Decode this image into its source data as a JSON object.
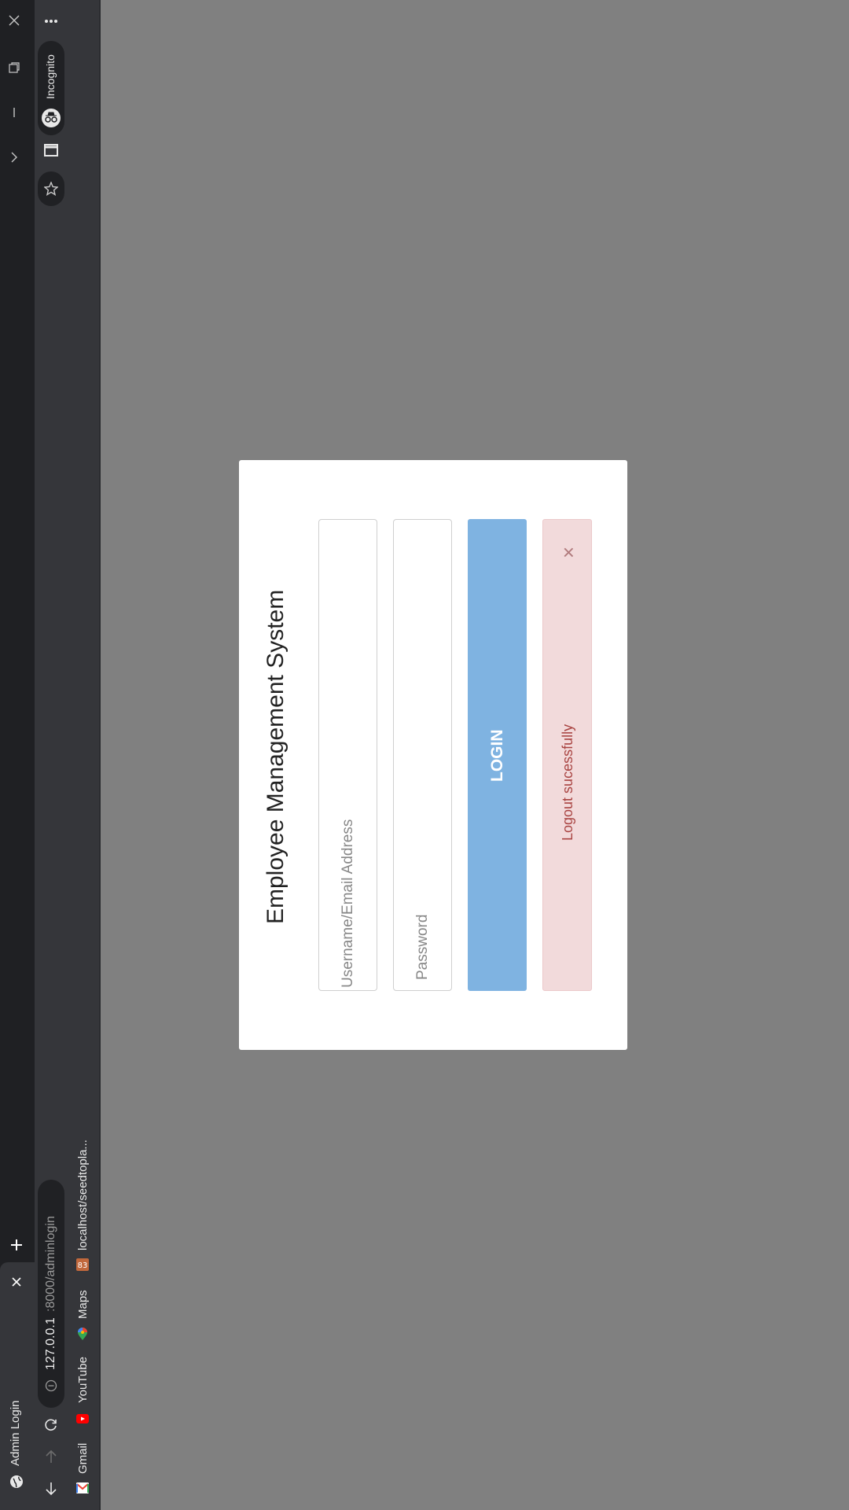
{
  "browser": {
    "tab_title": "Admin Login",
    "incognito_label": "Incognito",
    "url_host": "127.0.0.1",
    "url_rest": ":8000/adminlogin",
    "bookmarks": [
      {
        "label": "Gmail"
      },
      {
        "label": "YouTube"
      },
      {
        "label": "Maps"
      },
      {
        "label": "localhost/seedtopla..."
      }
    ],
    "colors": {
      "tabstrip": "#1f2023",
      "toolbar": "#35363a"
    }
  },
  "login": {
    "title": "Employee Management System",
    "username_placeholder": "Username/Email Address",
    "password_placeholder": "Password",
    "login_label": "LOGIN",
    "alert_message": "Logout sucessfully",
    "alert_close": "×",
    "colors": {
      "button": "#7fb3e1",
      "alert_bg": "#f2dadb",
      "alert_text": "#a94442"
    }
  }
}
